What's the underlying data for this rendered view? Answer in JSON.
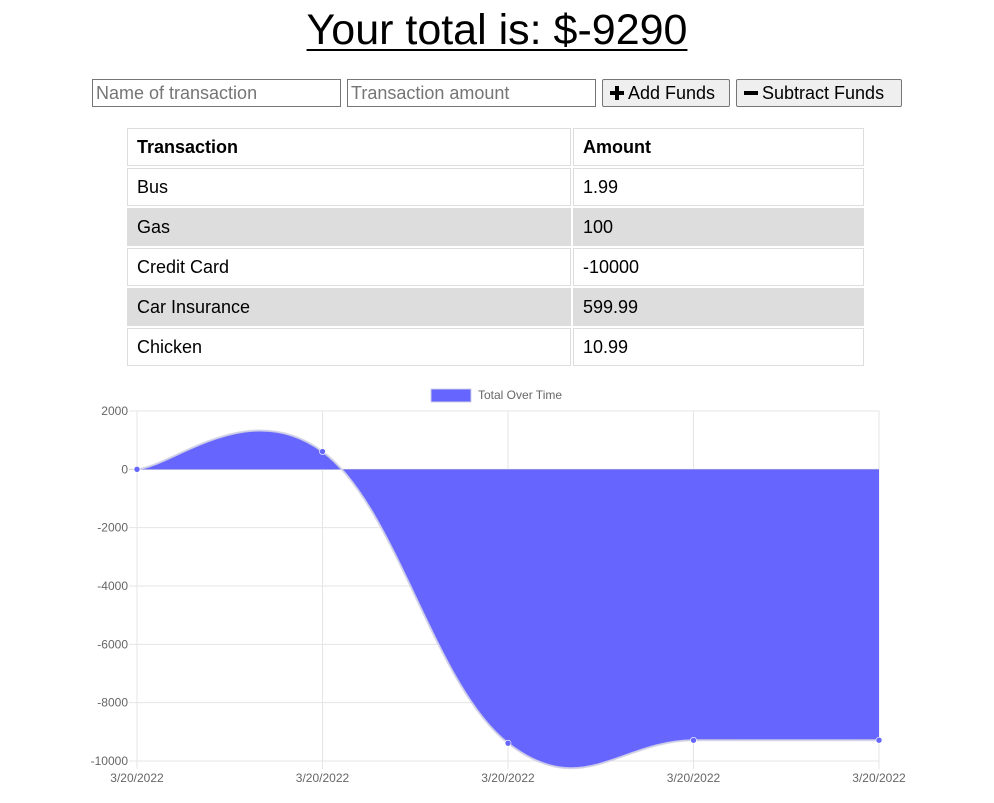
{
  "header": {
    "title": "Your total is: $-9290"
  },
  "form": {
    "name_placeholder": "Name of transaction",
    "amount_placeholder": "Transaction amount",
    "add_label": "Add Funds",
    "subtract_label": "Subtract Funds"
  },
  "table": {
    "headers": [
      "Transaction",
      "Amount"
    ],
    "rows": [
      {
        "name": "Bus",
        "amount": "1.99"
      },
      {
        "name": "Gas",
        "amount": "100"
      },
      {
        "name": "Credit Card",
        "amount": "-10000"
      },
      {
        "name": "Car Insurance",
        "amount": "599.99"
      },
      {
        "name": "Chicken",
        "amount": "10.99"
      }
    ]
  },
  "colors": {
    "series_fill": "#6666ff",
    "grid": "#e5e5e5",
    "alt_row": "#dddddd"
  },
  "chart_data": {
    "type": "area",
    "title": "",
    "xlabel": "",
    "ylabel": "",
    "x": [
      "3/20/2022",
      "3/20/2022",
      "3/20/2022",
      "3/20/2022",
      "3/20/2022"
    ],
    "series": [
      {
        "name": "Total Over Time",
        "values": [
          0,
          610.98,
          -9389.02,
          -9289.03,
          -9287.04
        ],
        "color": "#6666ff"
      }
    ],
    "ylim": [
      -10000,
      2000
    ],
    "yticks": [
      2000,
      0,
      -2000,
      -4000,
      -6000,
      -8000,
      -10000
    ],
    "grid": true,
    "legend": "top-center",
    "smooth": true
  }
}
